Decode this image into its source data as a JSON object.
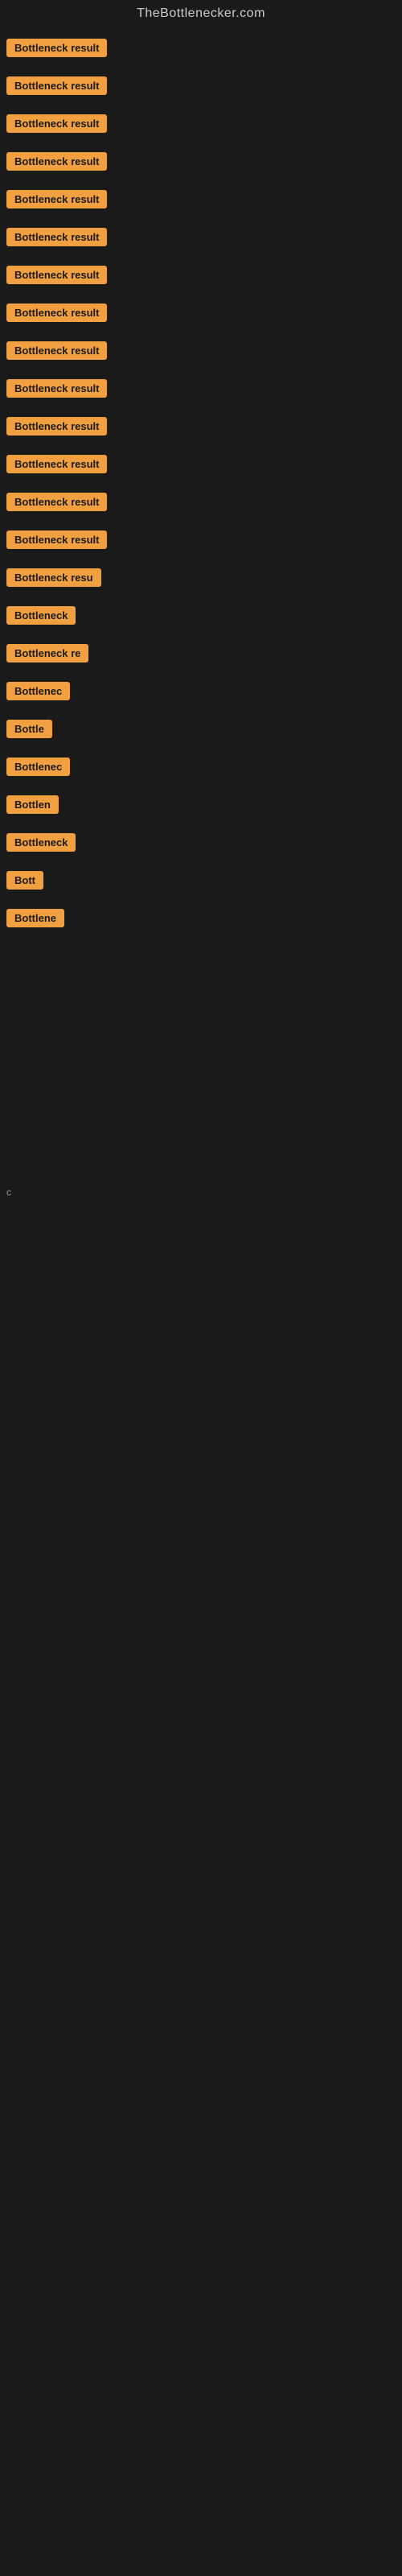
{
  "site": {
    "title": "TheBottlenecker.com"
  },
  "items": [
    {
      "id": 1,
      "label": "Bottleneck result",
      "width": 140
    },
    {
      "id": 2,
      "label": "Bottleneck result",
      "width": 140
    },
    {
      "id": 3,
      "label": "Bottleneck result",
      "width": 140
    },
    {
      "id": 4,
      "label": "Bottleneck result",
      "width": 140
    },
    {
      "id": 5,
      "label": "Bottleneck result",
      "width": 140
    },
    {
      "id": 6,
      "label": "Bottleneck result",
      "width": 140
    },
    {
      "id": 7,
      "label": "Bottleneck result",
      "width": 140
    },
    {
      "id": 8,
      "label": "Bottleneck result",
      "width": 140
    },
    {
      "id": 9,
      "label": "Bottleneck result",
      "width": 140
    },
    {
      "id": 10,
      "label": "Bottleneck result",
      "width": 140
    },
    {
      "id": 11,
      "label": "Bottleneck result",
      "width": 140
    },
    {
      "id": 12,
      "label": "Bottleneck result",
      "width": 140
    },
    {
      "id": 13,
      "label": "Bottleneck result",
      "width": 140
    },
    {
      "id": 14,
      "label": "Bottleneck result",
      "width": 140
    },
    {
      "id": 15,
      "label": "Bottleneck resu",
      "width": 120
    },
    {
      "id": 16,
      "label": "Bottleneck",
      "width": 90
    },
    {
      "id": 17,
      "label": "Bottleneck re",
      "width": 105
    },
    {
      "id": 18,
      "label": "Bottlenec",
      "width": 80
    },
    {
      "id": 19,
      "label": "Bottle",
      "width": 60
    },
    {
      "id": 20,
      "label": "Bottlenec",
      "width": 80
    },
    {
      "id": 21,
      "label": "Bottlen",
      "width": 68
    },
    {
      "id": 22,
      "label": "Bottleneck",
      "width": 90
    },
    {
      "id": 23,
      "label": "Bott",
      "width": 50
    },
    {
      "id": 24,
      "label": "Bottlene",
      "width": 75
    }
  ],
  "bottom_char": "c"
}
